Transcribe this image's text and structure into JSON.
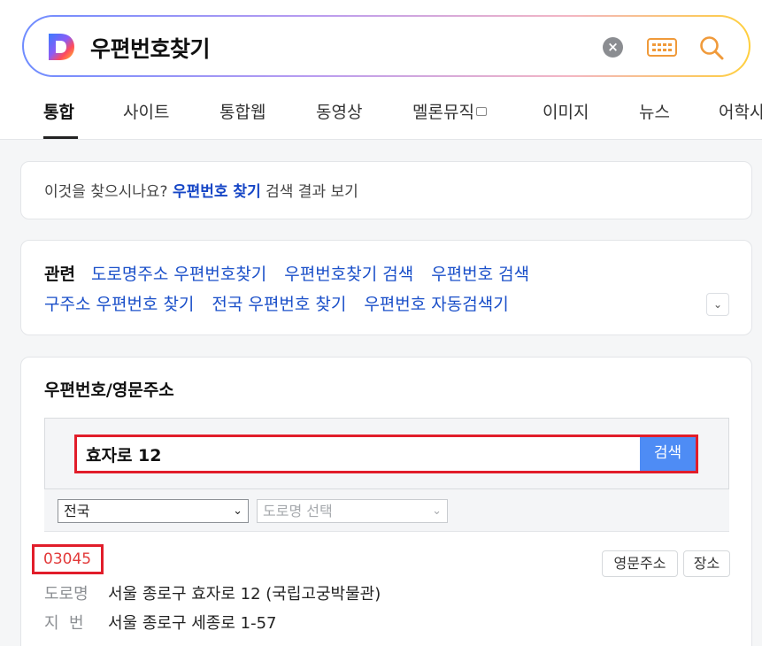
{
  "search": {
    "query": "우편번호찾기"
  },
  "tabs": [
    {
      "label": "통합",
      "active": true
    },
    {
      "label": "사이트"
    },
    {
      "label": "통합웹"
    },
    {
      "label": "동영상"
    },
    {
      "label": "멜론뮤직"
    },
    {
      "label": "이미지"
    },
    {
      "label": "뉴스"
    },
    {
      "label": "어학사"
    }
  ],
  "suggest": {
    "prefix": "이것을 찾으시나요?",
    "link": "우편번호 찾기",
    "suffix": "검색 결과 보기"
  },
  "related": {
    "title": "관련",
    "row1": [
      "도로명주소 우편번호찾기",
      "우편번호찾기 검색",
      "우편번호 검색"
    ],
    "row2": [
      "구주소 우편번호 찾기",
      "전국 우편번호 찾기",
      "우편번호 자동검색기"
    ]
  },
  "postal": {
    "title": "우편번호/영문주소",
    "input_value": "효자로 12",
    "search_button": "검색",
    "region_select": "전국",
    "road_select": "도로명 선택",
    "result": {
      "zip": "03045",
      "english_button": "영문주소",
      "place_button": "장소",
      "road_label": "도로명",
      "road_address": "서울 종로구 효자로 12 (국립고궁박물관)",
      "lot_label": "지  번",
      "lot_address": "서울 종로구 세종로 1-57"
    }
  },
  "colors": {
    "accent_blue": "#1a4fc9",
    "highlight_red": "#e11d2a",
    "button_blue": "#4e8cf5"
  }
}
